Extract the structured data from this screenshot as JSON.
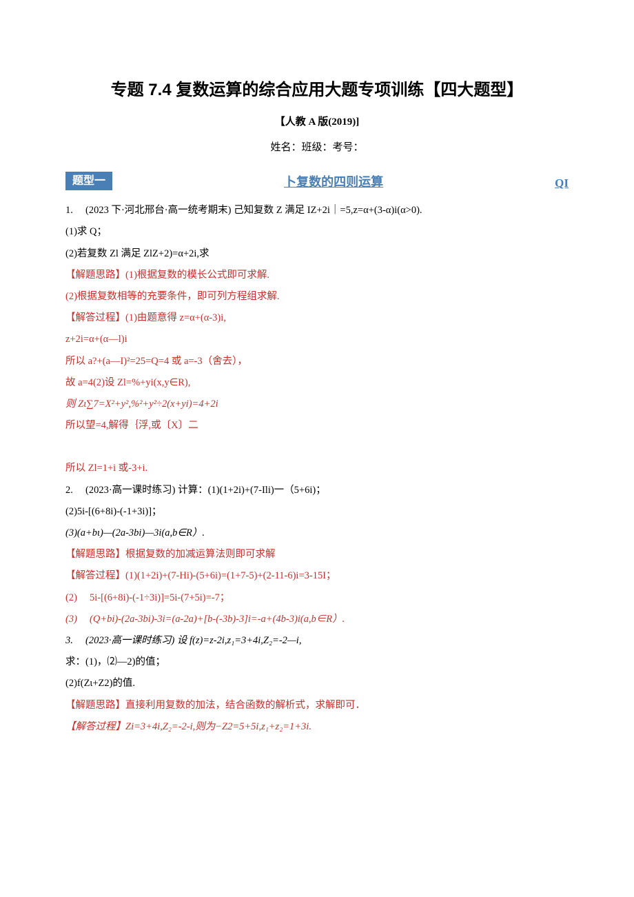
{
  "title": "专题 7.4 复数运算的综合应用大题专项训练【四大题型】",
  "subtitle": "【人教 A 版(2019)]",
  "meta": "姓名：班级：考号：",
  "section": {
    "badge": "题型一",
    "heading": "卜复数的四则运算",
    "qi": "QI"
  },
  "lines": [
    {
      "t": "1.　 (2023 下·河北邢台·高一统考期末) 己知复数 Z 满足 IZ+2i｜=5,z=α+(3-α)i(α>0).",
      "cls": ""
    },
    {
      "t": "(1)求 Q；",
      "cls": ""
    },
    {
      "t": "(2)若复数 Zl 满足 ZlZ+2)=α+2i,求",
      "cls": ""
    },
    {
      "t": "【解题思路】(1)根据复数的模长公式即可求解.",
      "cls": "red"
    },
    {
      "t": "(2)根据复数相等的充要条件，即可列方程组求解.",
      "cls": "red"
    },
    {
      "t": "【解答过程】(1)由题意得 z=α+(α-3)i,",
      "cls": "red"
    },
    {
      "t": "z+2i=α+(α—l)i",
      "cls": "red"
    },
    {
      "t": "所以 a?+(a—I)²=25=Q=4 或 a=-3（舍去），",
      "cls": "red"
    },
    {
      "t": "故 a=4(2)设 Zl=%+yi(x,y∈R),",
      "cls": "red"
    },
    {
      "t": "则 Zι∑7=X²+y²,%²+y²÷2(x+yi)=4+2i",
      "cls": "red italic"
    },
    {
      "t": "所以望=4,解得｛浮,或〔X〕二",
      "cls": "red"
    },
    {
      "t": "",
      "cls": ""
    },
    {
      "t": "所以 Zl=1+i 或-3+i.",
      "cls": "red"
    },
    {
      "t": "2.　 (2023·高一课时练习) 计算：(1)(1+2i)+(7-Ili)一（5+6i)；",
      "cls": ""
    },
    {
      "t": "(2)5i-[(6+8i)-(-1+3i)]；",
      "cls": ""
    },
    {
      "t": "(3)(a+bι)—(2a-3bi)—3i(a,b∈R）.",
      "cls": "italic"
    },
    {
      "t": "【解题思路】根据复数的加减运算法则即可求解",
      "cls": "red"
    },
    {
      "t": "【解答过程】(1)(1+2i)+(7-Hi)-(5+6i)=(1+7-5)+(2-11-6)i=3-15I；",
      "cls": "red"
    },
    {
      "t": "(2)　 5i-[(6+8i)-(-1÷3i)]=5i-(7+5i)=-7；",
      "cls": "red"
    },
    {
      "t": "(3)　 (Q+bi)-(2a-3bi)-3i=(a-2a)+[b-(-3b)-3]i=-a+(4b-3)i(a,b∈R）.",
      "cls": "red italic"
    },
    {
      "t": "3.　 (2023·高一课时练习) 设 f(z)=z-2i,z₁=3+4i,Z₂=-2—i,",
      "cls": "italic"
    },
    {
      "t": "求：(1)，⑵—2)的值；",
      "cls": ""
    },
    {
      "t": "(2)f(Zι+Z2)的值.",
      "cls": ""
    },
    {
      "t": "【解题思路】直接利用复数的加法，结合函数的解析式，求解即可．",
      "cls": "red"
    },
    {
      "t": "【解答过程】Zi=3+4i,Z₂=-2-i,则为−Z2=5+5i,z₁+z₂=1+3i.",
      "cls": "red italic"
    }
  ]
}
